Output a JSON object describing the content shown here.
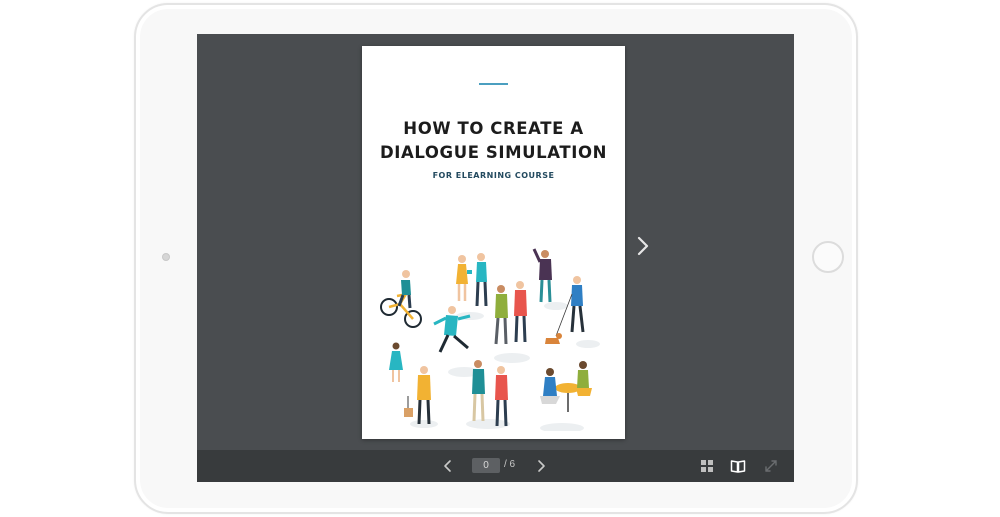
{
  "page": {
    "title": "HOW TO CREATE A\nDIALOGUE SIMULATION",
    "subtitle": "FOR ELEARNING COURSE"
  },
  "toolbar": {
    "current_page": "0",
    "total_label": "/  6",
    "icons": {
      "prev": "chevron-left-icon",
      "next": "chevron-right-icon",
      "grid": "grid-view-icon",
      "book": "book-view-icon",
      "fullscreen": "fullscreen-icon"
    }
  },
  "colors": {
    "screen_bg": "#4a4d50",
    "toolbar_bg": "#383b3d",
    "accent_rule": "#4b9fc0",
    "subtitle": "#234a5f"
  }
}
